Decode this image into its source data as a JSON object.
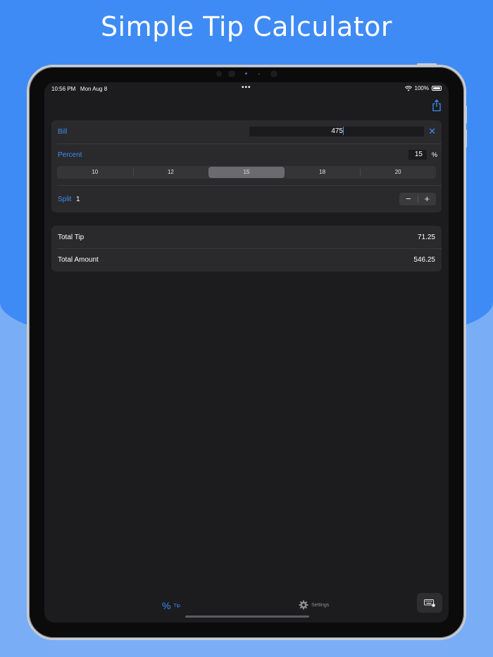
{
  "headline": "Simple Tip Calculator",
  "status_bar": {
    "time": "10:56 PM",
    "date": "Mon Aug 8",
    "battery": "100%",
    "icons": [
      "wifi-icon",
      "battery-icon"
    ]
  },
  "toolbar": {
    "share_icon": "share-icon"
  },
  "bill": {
    "label": "Bill",
    "value": "475",
    "clear_icon": "close-icon"
  },
  "percent": {
    "label": "Percent",
    "value": "15",
    "sign": "%",
    "options": [
      "10",
      "12",
      "15",
      "18",
      "20"
    ],
    "selected": "15"
  },
  "split": {
    "label": "Split",
    "value": "1",
    "decrement": "−",
    "increment": "+"
  },
  "totals": {
    "tip_label": "Total Tip",
    "tip_value": "71.25",
    "amount_label": "Total Amount",
    "amount_value": "546.25"
  },
  "tabs": [
    {
      "label": "Tip",
      "icon": "percent-icon",
      "active": true
    },
    {
      "label": "Settings",
      "icon": "gear-icon",
      "active": false
    }
  ],
  "colors": {
    "accent": "#3d8ef5",
    "background_top": "#3f8bf5",
    "background_bottom": "#79aef7",
    "screen": "#1c1b1d",
    "card": "#2a292c"
  }
}
